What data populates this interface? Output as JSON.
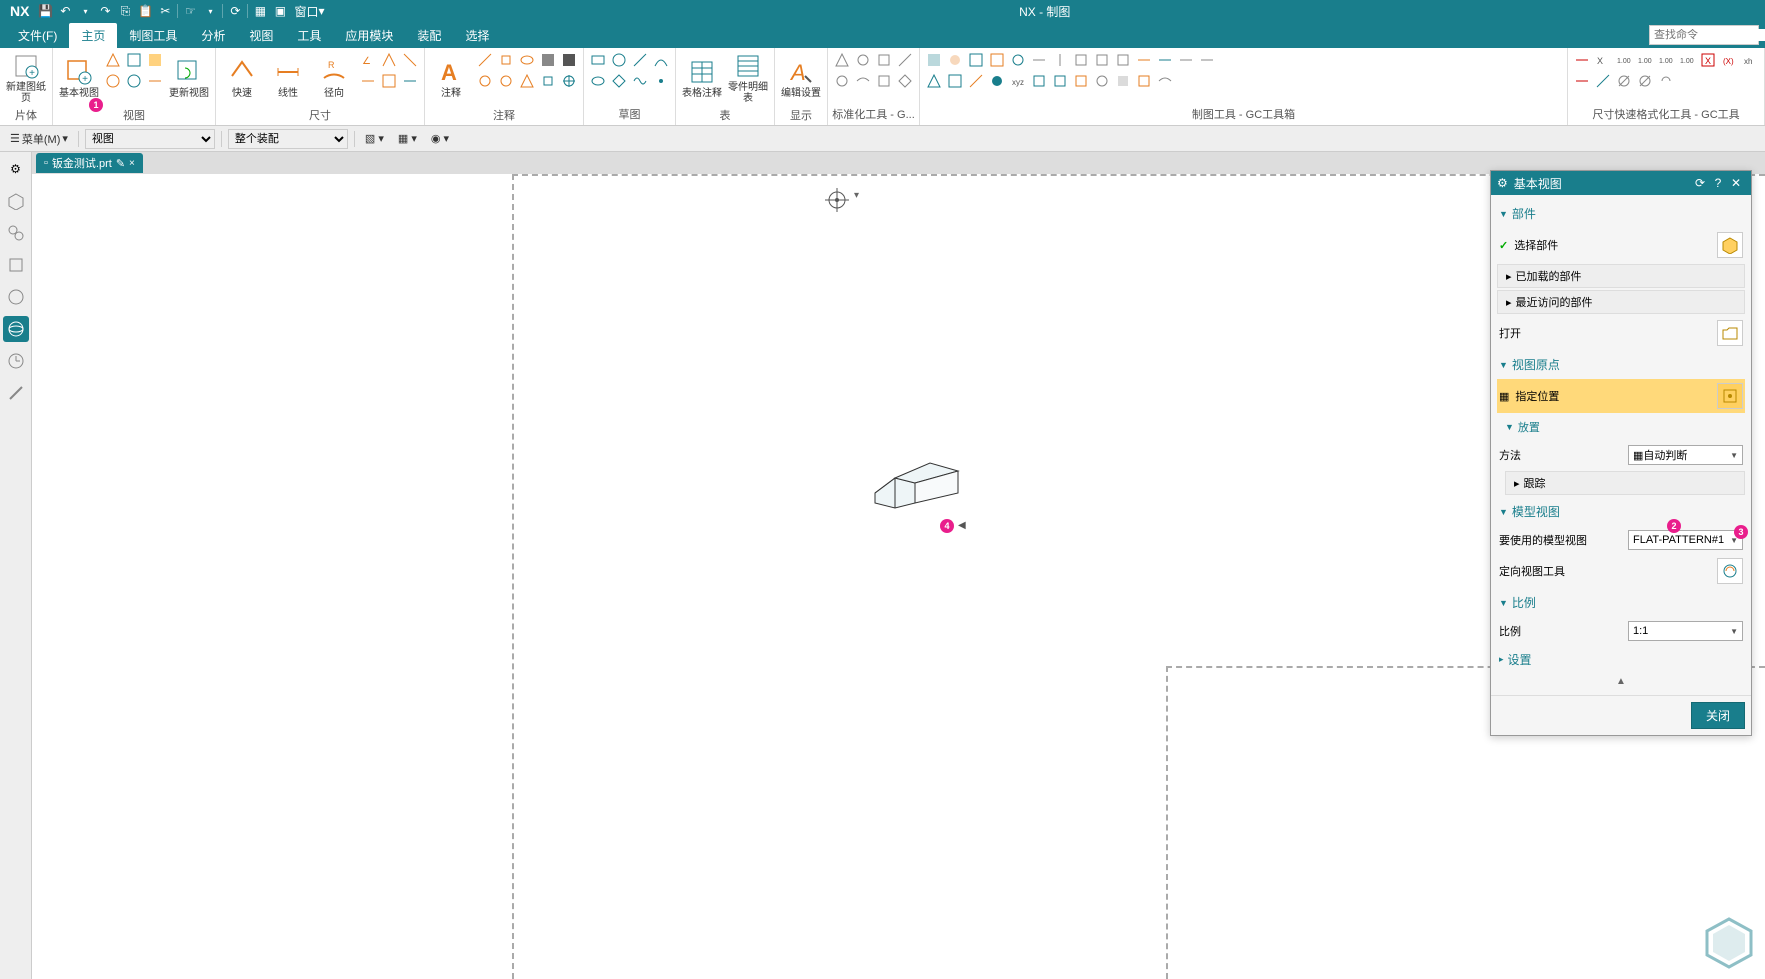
{
  "app": {
    "logo": "NX",
    "title": "NX - 制图"
  },
  "titlebar_icons": [
    "save",
    "undo",
    "redo",
    "copy",
    "paste",
    "cut",
    "touch",
    "repeat",
    "window"
  ],
  "titlebar_window_label": "窗口",
  "menubar": {
    "items": [
      {
        "label": "文件(F)"
      },
      {
        "label": "主页",
        "active": true
      },
      {
        "label": "制图工具"
      },
      {
        "label": "分析"
      },
      {
        "label": "视图"
      },
      {
        "label": "工具"
      },
      {
        "label": "应用模块"
      },
      {
        "label": "装配"
      },
      {
        "label": "选择"
      }
    ],
    "search_placeholder": "查找命令"
  },
  "ribbon": {
    "groups": [
      {
        "label": "片体",
        "big": [
          {
            "text": "新建图纸页"
          }
        ]
      },
      {
        "label": "视图",
        "big": [
          {
            "text": "基本视图"
          },
          {
            "text": "更新视图"
          }
        ]
      },
      {
        "label": "尺寸",
        "big": [
          {
            "text": "快速"
          },
          {
            "text": "线性"
          },
          {
            "text": "径向"
          }
        ]
      },
      {
        "label": "注释",
        "big": [
          {
            "text": "注释"
          }
        ]
      },
      {
        "label": "草图"
      },
      {
        "label": "表",
        "big": [
          {
            "text": "表格注释"
          },
          {
            "text": "零件明细表"
          }
        ]
      },
      {
        "label": "显示",
        "big": [
          {
            "text": "编辑设置"
          }
        ]
      },
      {
        "label": "标准化工具 - G..."
      },
      {
        "label": "制图工具 - GC工具箱"
      },
      {
        "label": "尺寸快速格式化工具 - GC工具"
      }
    ]
  },
  "toolbar2": {
    "menu_btn": "菜单(M)",
    "sel1": "视图",
    "sel2": "整个装配"
  },
  "doc_tab": "钣金测试.prt",
  "dialog": {
    "title": "基本视图",
    "sections": {
      "part": "部件",
      "select_part": "选择部件",
      "loaded": "已加载的部件",
      "recent": "最近访问的部件",
      "open": "打开",
      "view_origin": "视图原点",
      "specify_loc": "指定位置",
      "placement": "放置",
      "method": "方法",
      "method_val": "自动判断",
      "tracking": "跟踪",
      "model_view": "模型视图",
      "model_to_use": "要使用的模型视图",
      "model_val": "FLAT-PATTERN#1",
      "orient_tool": "定向视图工具",
      "scale": "比例",
      "scale_label": "比例",
      "scale_val": "1:1",
      "settings": "设置"
    },
    "close_btn": "关闭"
  },
  "badges": {
    "b1": "1",
    "b2": "2",
    "b3": "3",
    "b4": "4"
  }
}
